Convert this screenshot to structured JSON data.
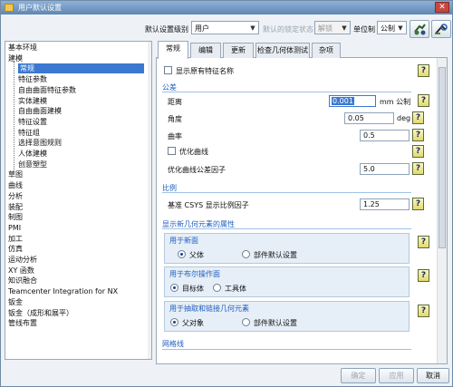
{
  "window": {
    "title": "用户默认设置",
    "close_glyph": "✕"
  },
  "toolbar": {
    "level_label": "默认设置级别",
    "level_value": "用户",
    "lock_label": "默认的锁定状态",
    "lock_value": "解锁",
    "unit_label": "单位制",
    "unit_value": "公制",
    "icons": [
      "manage-current-settings-icon",
      "find-default-icon"
    ]
  },
  "tree": {
    "items": [
      {
        "label": "基本环境",
        "level": 0
      },
      {
        "label": "建模",
        "level": 0
      },
      {
        "label": "常规",
        "level": 1,
        "selected": true
      },
      {
        "label": "特征参数",
        "level": 1
      },
      {
        "label": "自由曲面特征参数",
        "level": 1
      },
      {
        "label": "实体建模",
        "level": 1
      },
      {
        "label": "自由曲面建模",
        "level": 1
      },
      {
        "label": "特征设置",
        "level": 1
      },
      {
        "label": "特征组",
        "level": 1
      },
      {
        "label": "选择意图规则",
        "level": 1
      },
      {
        "label": "人体建模",
        "level": 1
      },
      {
        "label": "创意塑型",
        "level": 1
      },
      {
        "label": "草图",
        "level": 0
      },
      {
        "label": "曲线",
        "level": 0
      },
      {
        "label": "分析",
        "level": 0
      },
      {
        "label": "装配",
        "level": 0
      },
      {
        "label": "制图",
        "level": 0
      },
      {
        "label": "PMI",
        "level": 0
      },
      {
        "label": "加工",
        "level": 0
      },
      {
        "label": "仿真",
        "level": 0
      },
      {
        "label": "运动分析",
        "level": 0
      },
      {
        "label": "XY 函数",
        "level": 0
      },
      {
        "label": "知识融合",
        "level": 0
      },
      {
        "label": "Teamcenter Integration for NX",
        "level": 0
      },
      {
        "label": "钣金",
        "level": 0
      },
      {
        "label": "钣金（成形和展平）",
        "level": 0
      },
      {
        "label": "管线布置",
        "level": 0
      }
    ]
  },
  "tabs": [
    {
      "label": "常规",
      "active": true
    },
    {
      "label": "编辑"
    },
    {
      "label": "更新"
    },
    {
      "label": "检查几何体测试"
    },
    {
      "label": "杂项"
    }
  ],
  "general": {
    "show_feature_names": {
      "label": "显示原有特征名称",
      "checked": false
    },
    "tolerance": {
      "header": "公差",
      "distance": {
        "label": "距离",
        "value": "0.001",
        "unit": "mm 公制"
      },
      "angle": {
        "label": "角度",
        "value": "0.05",
        "unit": "deg"
      },
      "curvature": {
        "label": "曲率",
        "value": "0.5"
      },
      "optimize_curves": {
        "label": "优化曲线",
        "checked": false
      },
      "optimize_factor": {
        "label": "优化曲线公差因子",
        "value": "5.0"
      }
    },
    "scale": {
      "header": "比例",
      "csys_label": "基准 CSYS 显示比例因子",
      "csys_value": "1.25"
    },
    "new_geometry": {
      "header": "显示新几何元素的属性",
      "group_new_faces": {
        "title": "用于新面",
        "options": [
          {
            "label": "父体",
            "selected": true
          },
          {
            "label": "部件默认设置",
            "selected": false
          }
        ]
      },
      "group_boolean": {
        "title": "用于布尔操作面",
        "options": [
          {
            "label": "目标体",
            "selected": true
          },
          {
            "label": "工具体",
            "selected": false
          }
        ]
      },
      "group_extract": {
        "title": "用于抽取和链接几何元素",
        "options": [
          {
            "label": "父对象",
            "selected": true
          },
          {
            "label": "部件默认设置",
            "selected": false
          }
        ]
      }
    },
    "grid": {
      "header": "网格线"
    }
  },
  "help_glyph": "?",
  "buttons": {
    "ok": {
      "label": "确定",
      "enabled": false
    },
    "apply": {
      "label": "应用",
      "enabled": false
    },
    "cancel": {
      "label": "取消",
      "enabled": true
    }
  }
}
